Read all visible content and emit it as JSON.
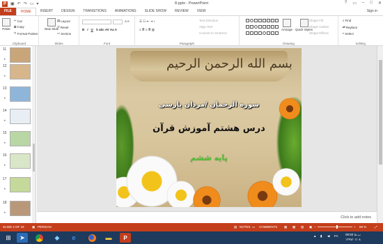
{
  "window": {
    "title": "8.pptx - PowerPoint",
    "sign_in": "Sign in"
  },
  "tabs": [
    "FILE",
    "HOME",
    "INSERT",
    "DESIGN",
    "TRANSITIONS",
    "ANIMATIONS",
    "SLIDE SHOW",
    "REVIEW",
    "VIEW"
  ],
  "ribbon": {
    "clipboard": {
      "label": "Clipboard",
      "paste": "Paste",
      "cut": "Cut",
      "copy": "Copy",
      "format_painter": "Format Painter"
    },
    "slides": {
      "label": "Slides",
      "new_slide": "New Slide",
      "layout": "Layout",
      "reset": "Reset",
      "section": "Section"
    },
    "font": {
      "label": "Font"
    },
    "paragraph": {
      "label": "Paragraph",
      "text_direction": "Text Direction",
      "align_text": "Align Text",
      "convert_smartart": "Convert to SmartArt"
    },
    "drawing": {
      "label": "Drawing",
      "arrange": "Arrange",
      "quick_styles": "Quick Styles",
      "shape_fill": "Shape Fill",
      "shape_outline": "Shape Outline",
      "shape_effects": "Shape Effects"
    },
    "editing": {
      "label": "Editing",
      "find": "Find",
      "replace": "Replace",
      "select": "Select"
    }
  },
  "thumbnails": [
    {
      "num": "11",
      "color": "#c9a57a"
    },
    {
      "num": "12",
      "color": "#d8b68b"
    },
    {
      "num": "13",
      "color": "#8fb6d9"
    },
    {
      "num": "14",
      "color": "#e8eef4"
    },
    {
      "num": "15",
      "color": "#b9d6a5"
    },
    {
      "num": "16",
      "color": "#d9e6c8"
    },
    {
      "num": "17",
      "color": "#c4d99a"
    },
    {
      "num": "18",
      "color": "#b9987a"
    }
  ],
  "slide": {
    "calligraphy": "بسم الله الرحمن الرحيم",
    "line1": "سوره الرحمان /مردان پارسی",
    "line2": "درس هشتم آموزش قرآن",
    "line3": "پایه ششم"
  },
  "notes_placeholder": "Click to add notes",
  "status": {
    "slide_info": "SLIDE 2 OF 19",
    "language": "PERSIAN",
    "notes": "NOTES",
    "comments": "COMMENTS",
    "zoom": "69 %"
  },
  "taskbar": {
    "lang": "FA",
    "time": "09:50 ب.ظ",
    "date": "۱۳۹۷/۰۱/۰۸"
  },
  "colors": {
    "accent": "#c43e1c",
    "taskbar": "#1e3a5c"
  }
}
